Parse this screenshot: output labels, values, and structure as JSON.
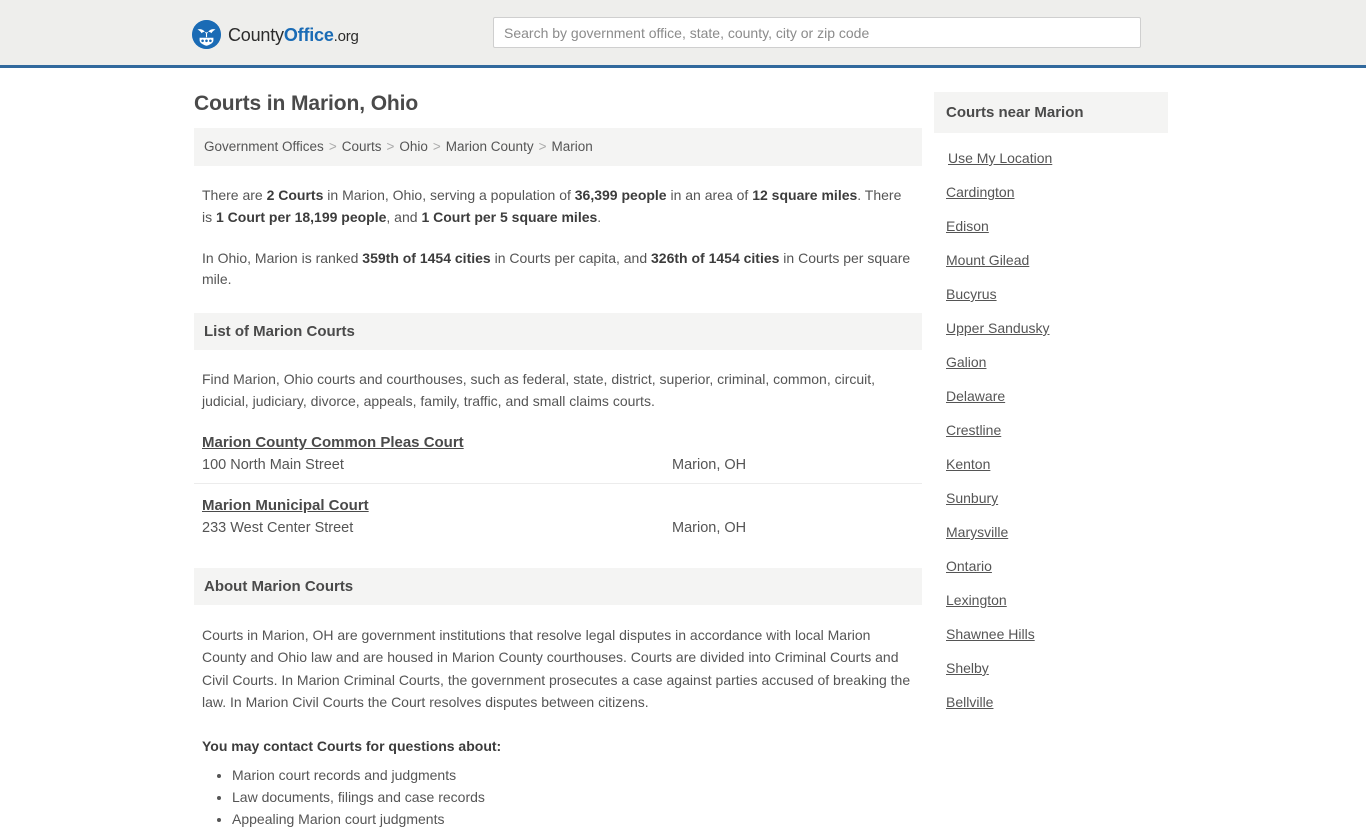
{
  "header": {
    "logo": {
      "icon": "eagle-shield-icon",
      "text_county": "County",
      "text_office": "Office",
      "text_org": ".org"
    },
    "search": {
      "placeholder": "Search by government office, state, county, city or zip code",
      "value": ""
    },
    "accent_color": "#31699d",
    "background_color": "#eeeeec"
  },
  "page": {
    "title": "Courts in Marion, Ohio"
  },
  "breadcrumb": {
    "separator": ">",
    "items": [
      {
        "label": "Government Offices"
      },
      {
        "label": "Courts"
      },
      {
        "label": "Ohio"
      },
      {
        "label": "Marion County"
      },
      {
        "label": "Marion"
      }
    ]
  },
  "intro": {
    "paragraph1_parts": [
      {
        "text": "There are ",
        "bold": false
      },
      {
        "text": "2 Courts",
        "bold": true
      },
      {
        "text": " in Marion, Ohio, serving a population of ",
        "bold": false
      },
      {
        "text": "36,399 people",
        "bold": true
      },
      {
        "text": " in an area of ",
        "bold": false
      },
      {
        "text": "12 square miles",
        "bold": true
      },
      {
        "text": ". There is ",
        "bold": false
      },
      {
        "text": "1 Court per 18,199 people",
        "bold": true
      },
      {
        "text": ", and ",
        "bold": false
      },
      {
        "text": "1 Court per 5 square miles",
        "bold": true
      },
      {
        "text": ".",
        "bold": false
      }
    ],
    "paragraph2_parts": [
      {
        "text": "In Ohio, Marion is ranked ",
        "bold": false
      },
      {
        "text": "359th of 1454 cities",
        "bold": true
      },
      {
        "text": " in Courts per capita, and ",
        "bold": false
      },
      {
        "text": "326th of 1454 cities",
        "bold": true
      },
      {
        "text": " in Courts per square mile.",
        "bold": false
      }
    ]
  },
  "list_section": {
    "heading": "List of Marion Courts",
    "description": "Find Marion, Ohio courts and courthouses, such as federal, state, district, superior, criminal, common, circuit, judicial, judiciary, divorce, appeals, family, traffic, and small claims courts.",
    "courts": [
      {
        "name": "Marion County Common Pleas Court",
        "address": "100 North Main Street",
        "city_state": "Marion, OH"
      },
      {
        "name": "Marion Municipal Court",
        "address": "233 West Center Street",
        "city_state": "Marion, OH"
      }
    ]
  },
  "about_section": {
    "heading": "About Marion Courts",
    "paragraph": "Courts in Marion, OH are government institutions that resolve legal disputes in accordance with local Marion County and Ohio law and are housed in Marion County courthouses. Courts are divided into Criminal Courts and Civil Courts. In Marion Criminal Courts, the government prosecutes a case against parties accused of breaking the law. In Marion Civil Courts the Court resolves disputes between citizens.",
    "contact_lead": "You may contact Courts for questions about:",
    "contact_items": [
      "Marion court records and judgments",
      "Law documents, filings and case records",
      "Appealing Marion court judgments"
    ]
  },
  "sidebar": {
    "heading": "Courts near Marion",
    "use_my_location": "Use My Location",
    "cities": [
      {
        "label": "Cardington"
      },
      {
        "label": "Edison"
      },
      {
        "label": "Mount Gilead"
      },
      {
        "label": "Bucyrus"
      },
      {
        "label": "Upper Sandusky"
      },
      {
        "label": "Galion"
      },
      {
        "label": "Delaware"
      },
      {
        "label": "Crestline"
      },
      {
        "label": "Kenton"
      },
      {
        "label": "Sunbury"
      },
      {
        "label": "Marysville"
      },
      {
        "label": "Ontario"
      },
      {
        "label": "Lexington"
      },
      {
        "label": "Shawnee Hills"
      },
      {
        "label": "Shelby"
      },
      {
        "label": "Bellville"
      }
    ]
  }
}
